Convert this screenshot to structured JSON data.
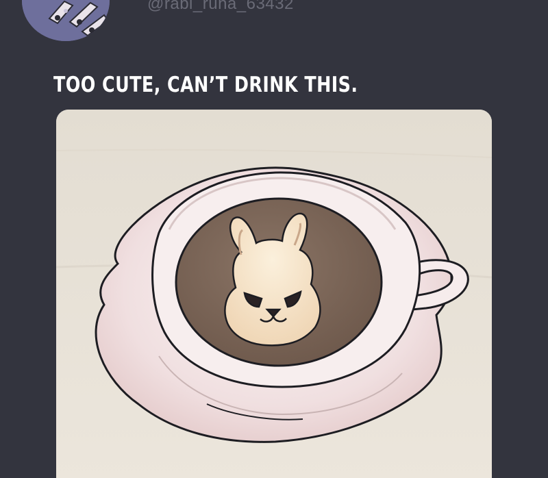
{
  "post": {
    "handle": "@rabi_runa_63432",
    "caption": "TOO CUTE, CAN’T DRINK THIS."
  },
  "colors": {
    "background": "#33343e",
    "avatar": "#6e6f9c",
    "handle_text": "#6a6b77",
    "caption_text": "#ffffff",
    "table": "#e7e1d7",
    "coffee": "#7a6457",
    "latte_art": "#f4e3c6"
  },
  "icons": {
    "avatar": "avatar-painted-nails",
    "image": "latte-art-bunny"
  }
}
